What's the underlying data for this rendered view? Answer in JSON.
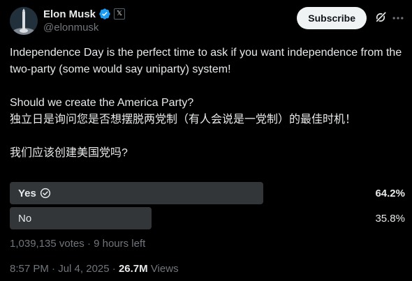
{
  "author": {
    "display_name": "Elon Musk",
    "handle": "@elonmusk",
    "affiliation_badge": "𝕏",
    "icons": {
      "avatar": "rocket-launch-avatar",
      "verified": "verified-badge-icon"
    }
  },
  "header": {
    "subscribe_label": "Subscribe"
  },
  "tweet": {
    "line1": "Independence Day is the perfect time to ask if you want independence from the two-party (some would say uniparty) system!",
    "line2": "Should we create the America Party?",
    "line3": "独立日是询问您是否想摆脱两党制（有人会说是一党制）的最佳时机！",
    "line4": "我们应该创建美国党吗?"
  },
  "poll": {
    "options": [
      {
        "label": "Yes",
        "percent_text": "64.2%",
        "fraction": 0.642,
        "winner": true
      },
      {
        "label": "No",
        "percent_text": "35.8%",
        "fraction": 0.358,
        "winner": false
      }
    ],
    "votes_text": "1,039,135 votes",
    "time_left": "9 hours left",
    "separator": "·"
  },
  "meta": {
    "time": "8:57 PM",
    "date": "Jul 4, 2025",
    "views_count": "26.7M",
    "views_label": "Views",
    "separator": "·"
  },
  "colors": {
    "background": "#000000",
    "text": "#e7e9ea",
    "muted": "#71767b",
    "verified_blue": "#1d9bf0",
    "poll_bar": "#333639",
    "subscribe_bg": "#eff3f4"
  }
}
